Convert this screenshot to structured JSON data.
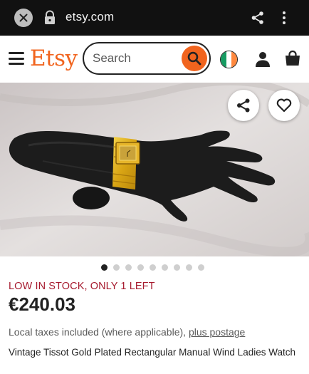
{
  "browser": {
    "url": "etsy.com",
    "icons": [
      "close-icon",
      "lock-icon",
      "share-icon",
      "more-vert-icon"
    ]
  },
  "header": {
    "logo": "Etsy",
    "search_placeholder": "Search",
    "icons": [
      "menu-icon",
      "search-icon",
      "ireland-flag-icon",
      "user-icon",
      "shopping-bag-icon"
    ]
  },
  "gallery": {
    "image_count": 9,
    "active_index": 0,
    "actions": [
      "share-icon",
      "heart-icon"
    ]
  },
  "product": {
    "stock_notice": "LOW IN STOCK, ONLY 1 LEFT",
    "price": "€240.03",
    "taxes_text": "Local taxes included (where applicable), ",
    "postage_link": "plus postage",
    "title": "Vintage Tissot Gold Plated Rectangular Manual Wind Ladies Watch"
  },
  "colors": {
    "brand": "#f1641e",
    "stock_red": "#a61a2e",
    "chrome_bg": "#111111"
  }
}
